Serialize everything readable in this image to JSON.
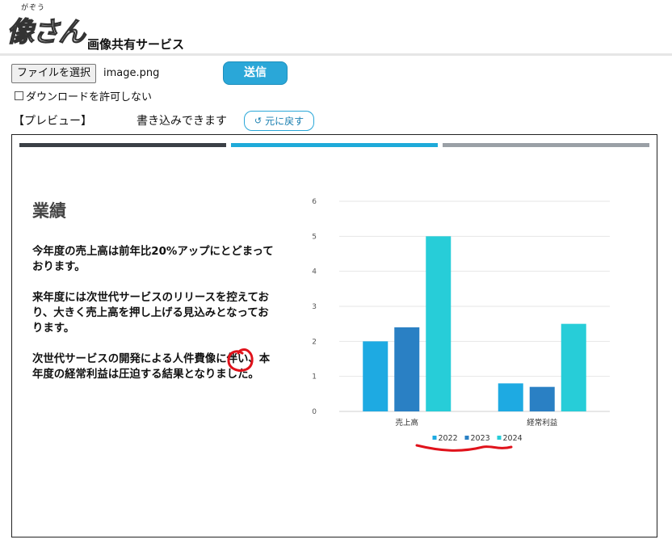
{
  "header": {
    "logo_ruby": "がぞう",
    "logo_text": "像さん",
    "title": "画像共有サービス"
  },
  "upload": {
    "file_button": "ファイルを選択",
    "file_name": "image.png",
    "send_button": "送信",
    "no_download_label": "ダウンロードを許可しない",
    "no_download_checked": false
  },
  "preview_bar": {
    "preview_label": "【プレビュー】",
    "writable_label": "書き込みできます",
    "revert_button": "元に戻す"
  },
  "slide": {
    "title": "業績",
    "paragraphs": [
      "今年度の売上高は前年比20%アップにとどまっております。",
      "来年度には次世代サービスのリリースを控えており、大きく売上高を押し上げる見込みとなっております。",
      "次世代サービスの開発による人件費像に伴い、本年度の経常利益は圧迫する結果となりました。"
    ],
    "colors": {
      "bar_dark": "#3b4046",
      "bar_blue": "#1eaad9",
      "bar_gray": "#9aa0a6"
    }
  },
  "chart_data": {
    "type": "bar",
    "categories": [
      "売上高",
      "経常利益"
    ],
    "series": [
      {
        "name": "2022",
        "values": [
          2.0,
          0.8
        ],
        "color": "#1eaae2"
      },
      {
        "name": "2023",
        "values": [
          2.4,
          0.7
        ],
        "color": "#2a80c4"
      },
      {
        "name": "2024",
        "values": [
          5.0,
          2.5
        ],
        "color": "#27cdd8"
      }
    ],
    "ylim": [
      0,
      6
    ],
    "yticks": [
      "0",
      "1",
      "2",
      "3",
      "4",
      "5",
      "6"
    ],
    "grid": true,
    "legend": "bottom",
    "title": "",
    "xlabel": "",
    "ylabel": ""
  },
  "annotation_color": "#e0121b"
}
